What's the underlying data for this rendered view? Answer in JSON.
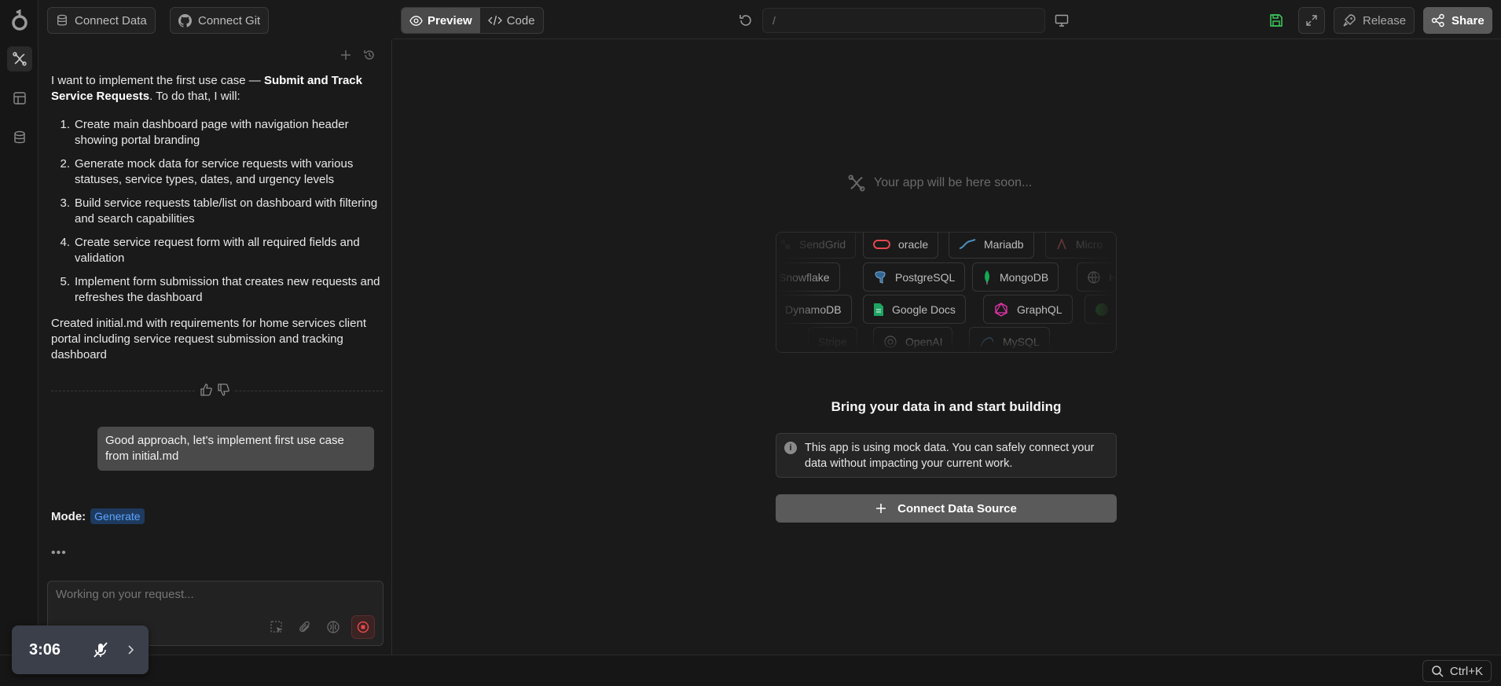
{
  "topbar": {
    "connect_data": "Connect Data",
    "connect_git": "Connect Git",
    "preview": "Preview",
    "code": "Code",
    "url": "/",
    "release": "Release",
    "share": "Share"
  },
  "chat": {
    "intro_prefix": "I want to implement the first use case — ",
    "intro_bold": "Submit and Track Service Requests",
    "intro_suffix": ". To do that, I will:",
    "steps": [
      {
        "num": "1.",
        "text": "Create main dashboard page with navigation header showing portal branding"
      },
      {
        "num": "2.",
        "text": "Generate mock data for service requests with various statuses, service types, dates, and urgency levels"
      },
      {
        "num": "3.",
        "text": "Build service requests table/list on dashboard with filtering and search capabilities"
      },
      {
        "num": "4.",
        "text": "Create service request form with all required fields and validation"
      },
      {
        "num": "5.",
        "text": "Implement form submission that creates new requests and refreshes the dashboard"
      }
    ],
    "summary": "Created initial.md with requirements for home services client portal including service request submission and tracking dashboard",
    "user_message": "Good approach, let's implement first use case from initial.md",
    "mode_label": "Mode:",
    "mode_value": "Generate",
    "typing": "•••",
    "input_placeholder": "Working on your request..."
  },
  "timer": {
    "time": "3:06"
  },
  "statusbar": {
    "search_shortcut": "Ctrl+K"
  },
  "preview": {
    "soon": "Your app will be here soon...",
    "integrations_row1": [
      "SendGrid",
      "oracle",
      "Mariadb",
      "Micro"
    ],
    "integrations_row2": [
      "Snowflake",
      "PostgreSQL",
      "MongoDB",
      "HT"
    ],
    "integrations_row3": [
      "DynamoDB",
      "Google Docs",
      "GraphQL"
    ],
    "integrations_row4": [
      "Stripe",
      "OpenAI",
      "MySQL"
    ],
    "headline": "Bring your data in and start building",
    "notice": "This app is using mock data. You can safely connect your data without impacting your current work.",
    "connect_button": "Connect Data Source"
  },
  "colors": {
    "accent_blue": "#5ea4ff",
    "save_green": "#3ecf5e",
    "stop_red": "#e5484d"
  }
}
